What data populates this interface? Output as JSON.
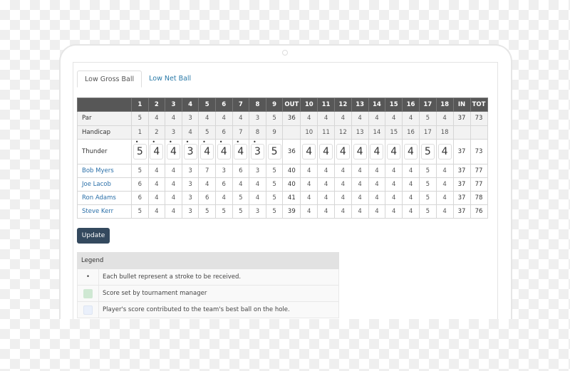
{
  "tabs": [
    {
      "label": "Low Gross Ball",
      "active": true
    },
    {
      "label": "Low Net Ball",
      "active": false
    }
  ],
  "scorecard": {
    "headers": [
      "",
      "1",
      "2",
      "3",
      "4",
      "5",
      "6",
      "7",
      "8",
      "9",
      "OUT",
      "10",
      "11",
      "12",
      "13",
      "14",
      "15",
      "16",
      "17",
      "18",
      "IN",
      "TOT"
    ],
    "par": {
      "label": "Par",
      "holes": [
        5,
        4,
        4,
        3,
        4,
        4,
        4,
        3,
        5,
        4,
        4,
        4,
        4,
        4,
        4,
        4,
        5,
        4
      ],
      "out": 36,
      "in": 37,
      "tot": 73
    },
    "handicap": {
      "label": "Handicap",
      "holes": [
        1,
        2,
        3,
        4,
        5,
        6,
        7,
        8,
        9,
        10,
        11,
        12,
        13,
        14,
        15,
        16,
        17,
        18
      ]
    },
    "team": {
      "label": "Thunder",
      "holes": [
        5,
        4,
        4,
        3,
        4,
        4,
        4,
        3,
        5,
        4,
        4,
        4,
        4,
        4,
        4,
        4,
        5,
        4
      ],
      "strokes": [
        1,
        2,
        3,
        4,
        5,
        6,
        7,
        8
      ],
      "manager_set": [
        6
      ],
      "out": 36,
      "in": 37,
      "tot": 73
    },
    "players": [
      {
        "name": "Bob Myers",
        "holes": [
          5,
          4,
          4,
          3,
          7,
          3,
          6,
          3,
          5,
          4,
          4,
          4,
          4,
          4,
          4,
          4,
          5,
          4
        ],
        "best": [
          1,
          2,
          3,
          4,
          6,
          8,
          9,
          10,
          11,
          12,
          13,
          14,
          15,
          16,
          17,
          18
        ],
        "out": 40,
        "in": 37,
        "tot": 77
      },
      {
        "name": "Joe Lacob",
        "holes": [
          6,
          4,
          4,
          3,
          4,
          6,
          4,
          4,
          5,
          4,
          4,
          4,
          4,
          4,
          4,
          4,
          5,
          4
        ],
        "best": [
          2,
          3,
          4,
          5,
          7,
          9,
          10,
          11,
          12,
          13,
          14,
          15,
          16,
          17,
          18
        ],
        "out": 40,
        "in": 37,
        "tot": 77
      },
      {
        "name": "Ron Adams",
        "holes": [
          6,
          4,
          4,
          3,
          6,
          4,
          5,
          4,
          5,
          4,
          4,
          4,
          4,
          4,
          4,
          4,
          5,
          4
        ],
        "best": [
          2,
          3,
          4,
          9,
          10,
          11,
          12,
          13,
          14,
          15,
          16,
          17,
          18
        ],
        "out": 41,
        "in": 37,
        "tot": 78
      },
      {
        "name": "Steve Kerr",
        "holes": [
          5,
          4,
          4,
          3,
          5,
          5,
          5,
          3,
          5,
          4,
          4,
          4,
          4,
          4,
          4,
          4,
          5,
          4
        ],
        "best": [
          1,
          2,
          3,
          4,
          8,
          9,
          10,
          11,
          12,
          13,
          14,
          15,
          16,
          17,
          18
        ],
        "out": 39,
        "in": 37,
        "tot": 76
      }
    ]
  },
  "update_label": "Update",
  "legend": {
    "title": "Legend",
    "items": [
      {
        "icon": "•",
        "text": "Each bullet represent a stroke to be received."
      },
      {
        "swatch": "#cfe8d3",
        "text": "Score set by tournament manager"
      },
      {
        "swatch": "#eaf0fb",
        "text": "Player's score contributed to the team's best ball on the hole."
      }
    ]
  }
}
